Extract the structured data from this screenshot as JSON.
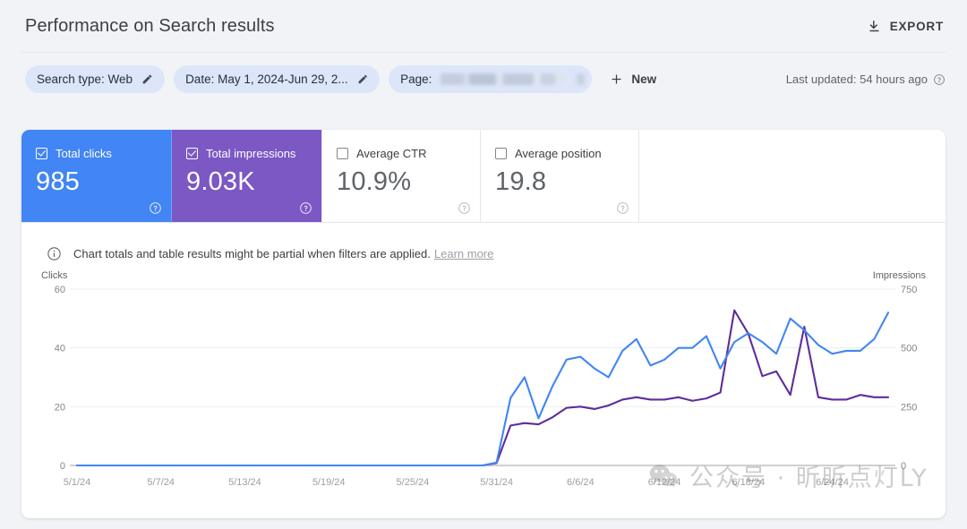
{
  "header": {
    "title": "Performance on Search results",
    "export_label": "EXPORT",
    "export_icon": "download-icon"
  },
  "filters": {
    "chips": [
      {
        "label": "Search type: Web",
        "icon": "pencil-icon",
        "blurred": false
      },
      {
        "label": "Date: May 1, 2024-Jun 29, 2...",
        "icon": "pencil-icon",
        "blurred": false
      },
      {
        "label": "Page: ",
        "icon": "",
        "blurred": true
      }
    ],
    "new_button": {
      "label": "New",
      "icon": "plus-icon"
    },
    "last_updated": "Last updated: 54 hours ago",
    "help_icon": "question-circle-icon"
  },
  "metrics": [
    {
      "label": "Total clicks",
      "value": "985",
      "checked": true,
      "color": "#4285f4",
      "help_icon": "question-circle-icon"
    },
    {
      "label": "Total impressions",
      "value": "9.03K",
      "checked": true,
      "color": "#7b58c4",
      "help_icon": "question-circle-icon"
    },
    {
      "label": "Average CTR",
      "value": "10.9%",
      "checked": false,
      "color": "#ffffff",
      "help_icon": "question-circle-icon"
    },
    {
      "label": "Average position",
      "value": "19.8",
      "checked": false,
      "color": "#ffffff",
      "help_icon": "question-circle-icon"
    }
  ],
  "banner": {
    "icon": "info-icon",
    "text": "Chart totals and table results might be partial when filters are applied.",
    "link": "Learn more"
  },
  "watermark": {
    "text": "公众号 · 昕昕点灯LY",
    "icon": "wechat-icon"
  },
  "chart_data": {
    "type": "line",
    "title": "",
    "xlabel": "",
    "grid": true,
    "legend": "none",
    "x_tick_labels": [
      "5/1/24",
      "5/7/24",
      "5/13/24",
      "5/19/24",
      "5/25/24",
      "5/31/24",
      "6/6/24",
      "6/12/24",
      "6/18/24",
      "6/24/24"
    ],
    "x_tick_indices": [
      0,
      6,
      12,
      18,
      24,
      30,
      36,
      42,
      48,
      54
    ],
    "left_axis": {
      "name": "Clicks",
      "ticks": [
        0,
        20,
        40,
        60
      ],
      "ylim": [
        0,
        60
      ]
    },
    "right_axis": {
      "name": "Impressions",
      "ticks": [
        0,
        250,
        500,
        750
      ],
      "ylim": [
        0,
        750
      ]
    },
    "series": [
      {
        "name": "Clicks",
        "color": "#4285f4",
        "axis": "left",
        "values": [
          0,
          0,
          0,
          0,
          0,
          0,
          0,
          0,
          0,
          0,
          0,
          0,
          0,
          0,
          0,
          0,
          0,
          0,
          0,
          0,
          0,
          0,
          0,
          0,
          0,
          0,
          0,
          0,
          0,
          0,
          1,
          23,
          30,
          16,
          27,
          36,
          37,
          33,
          30,
          39,
          43,
          34,
          36,
          40,
          40,
          44,
          33,
          42,
          45,
          42,
          38,
          50,
          46,
          41,
          38,
          39,
          39,
          43,
          52
        ]
      },
      {
        "name": "Impressions",
        "color": "#5e2d9b",
        "axis": "right",
        "values": [
          0,
          0,
          0,
          0,
          0,
          0,
          0,
          0,
          0,
          0,
          0,
          0,
          0,
          0,
          0,
          0,
          0,
          0,
          0,
          0,
          0,
          0,
          0,
          0,
          0,
          0,
          0,
          0,
          0,
          0,
          10,
          170,
          180,
          175,
          205,
          245,
          250,
          240,
          255,
          280,
          290,
          280,
          280,
          290,
          275,
          285,
          310,
          660,
          560,
          380,
          400,
          300,
          590,
          290,
          280,
          280,
          300,
          290,
          290
        ]
      }
    ]
  }
}
